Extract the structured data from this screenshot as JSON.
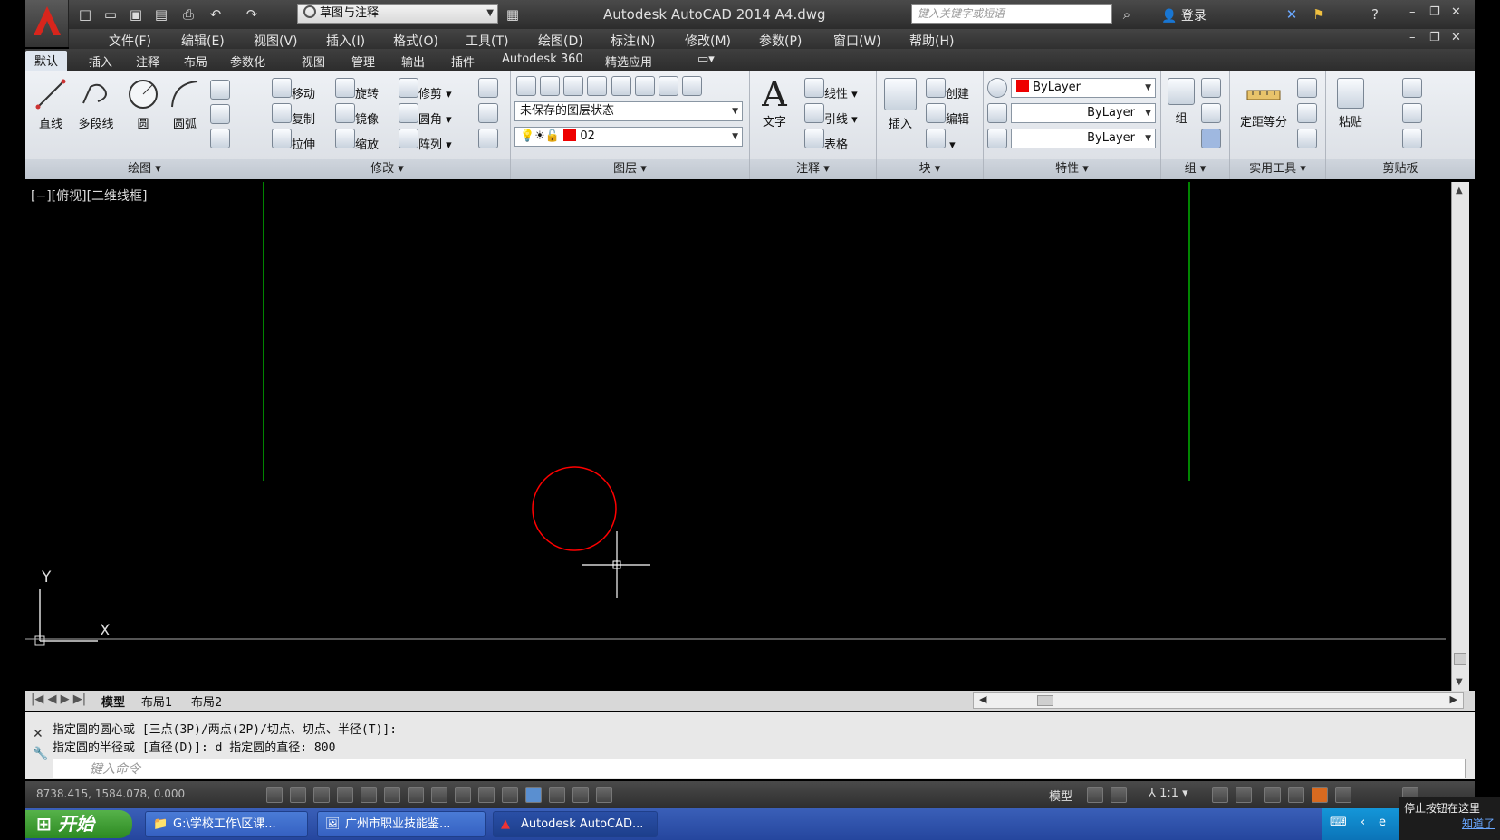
{
  "title_bar": {
    "workspace": "草图与注释",
    "app_title": "Autodesk AutoCAD 2014   A4.dwg",
    "search_placeholder": "键入关键字或短语",
    "login": "登录"
  },
  "menu": [
    "文件(F)",
    "编辑(E)",
    "视图(V)",
    "插入(I)",
    "格式(O)",
    "工具(T)",
    "绘图(D)",
    "标注(N)",
    "修改(M)",
    "参数(P)",
    "窗口(W)",
    "帮助(H)"
  ],
  "ribbon_tabs": [
    "默认",
    "插入",
    "注释",
    "布局",
    "参数化",
    "视图",
    "管理",
    "输出",
    "插件",
    "Autodesk 360",
    "精选应用"
  ],
  "panels": {
    "draw": {
      "title": "绘图",
      "line": "直线",
      "polyline": "多段线",
      "circle": "圆",
      "arc": "圆弧"
    },
    "modify": {
      "title": "修改",
      "move": "移动",
      "rotate": "旋转",
      "trim": "修剪",
      "copy": "复制",
      "mirror": "镜像",
      "fillet": "圆角",
      "stretch": "拉伸",
      "scale": "缩放",
      "array": "阵列"
    },
    "layers": {
      "title": "图层",
      "layer_state": "未保存的图层状态",
      "current_layer": "02"
    },
    "annotation": {
      "title": "注释",
      "text": "文字",
      "linear": "线性",
      "leader": "引线",
      "table": "表格"
    },
    "block": {
      "title": "块",
      "insert": "插入",
      "create": "创建",
      "edit": "编辑"
    },
    "properties": {
      "title": "特性",
      "color": "ByLayer",
      "linetype": "ByLayer",
      "lineweight": "ByLayer"
    },
    "groups": {
      "title": "组",
      "group": "组"
    },
    "utilities": {
      "title": "实用工具",
      "measure": "定距等分"
    },
    "clipboard": {
      "title": "剪贴板",
      "paste": "粘贴"
    }
  },
  "viewport_label": "[−][俯视][二维线框]",
  "ucs": {
    "x": "X",
    "y": "Y"
  },
  "layout_tabs": [
    "模型",
    "布局1",
    "布局2"
  ],
  "command": {
    "line1": "指定圆的圆心或 [三点(3P)/两点(2P)/切点、切点、半径(T)]:",
    "line2": "指定圆的半径或 [直径(D)]: d 指定圆的直径: 800",
    "placeholder": "键入命令"
  },
  "status": {
    "coords": "8738.415, 1584.078, 0.000",
    "model": "模型",
    "scale": "1:1"
  },
  "taskbar": {
    "start": "开始",
    "items": [
      "G:\\学校工作\\区课...",
      "广州市职业技能鉴...",
      "Autodesk AutoCAD..."
    ]
  },
  "tooltip": {
    "text": "停止按钮在这里",
    "link": "知道了"
  },
  "colors": {
    "circle": "#ff0000",
    "guide_lines": "#00b000",
    "crosshair": "#ffffff"
  }
}
